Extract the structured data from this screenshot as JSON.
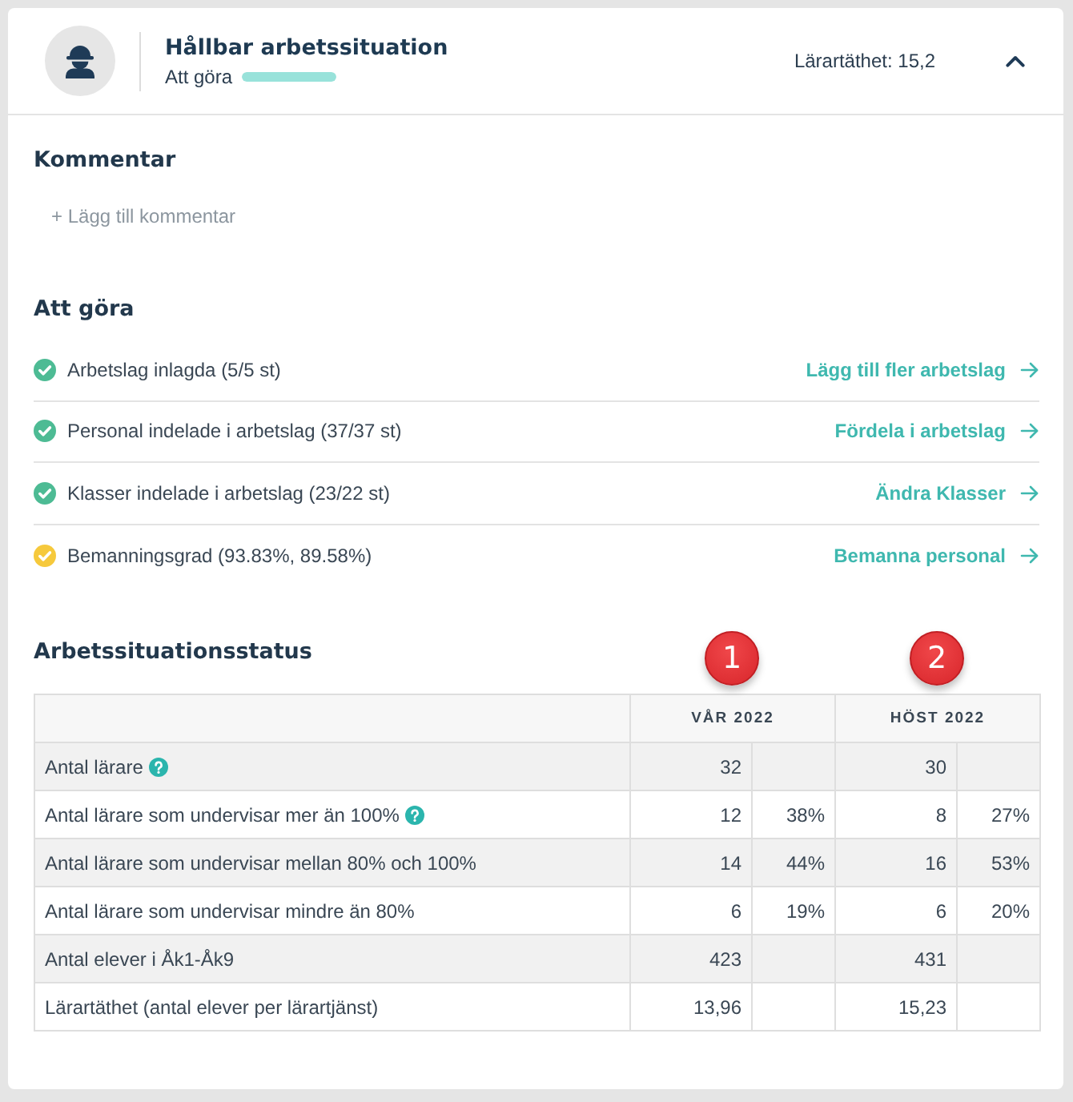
{
  "header": {
    "title": "Hållbar arbetssituation",
    "status_label": "Att göra",
    "progress": {
      "level": 1
    },
    "density": "Lärartäthet: 15,2",
    "expanded": true
  },
  "comment": {
    "heading": "Kommentar",
    "add_link": "+ Lägg till kommentar"
  },
  "todo": {
    "heading": "Att göra",
    "items": [
      {
        "text": "Arbetslag inlagda (5/5 st)",
        "color": "#4dbb94",
        "action": "Lägg till fler arbetslag"
      },
      {
        "text": "Personal indelade i arbetslag (37/37 st)",
        "color": "#4dbb94",
        "action": "Fördela i arbetslag"
      },
      {
        "text": "Klasser indelade i arbetslag (23/22 st)",
        "color": "#4dbb94",
        "action": "Ändra Klasser"
      },
      {
        "text": "Bemanningsgrad (93.83%, 89.58%)",
        "color": "#f6c93c",
        "action": "Bemanna personal"
      }
    ]
  },
  "status_table": {
    "heading": "Arbetssituationsstatus",
    "columns": [
      {
        "label": "VÅR 2022",
        "marker": "1"
      },
      {
        "label": "HÖST 2022",
        "marker": "2"
      }
    ],
    "rows": [
      {
        "label": "Antal lärare",
        "help": true,
        "values": [
          {
            "count": "32"
          },
          {
            "count": "30"
          }
        ]
      },
      {
        "label": "Antal lärare som undervisar mer än 100%",
        "help": true,
        "values": [
          {
            "count": "12",
            "share": "38%"
          },
          {
            "count": "8",
            "share": "27%"
          }
        ]
      },
      {
        "label": "Antal lärare som undervisar mellan 80% och 100%",
        "help": false,
        "values": [
          {
            "count": "14",
            "share": "44%"
          },
          {
            "count": "16",
            "share": "53%"
          }
        ]
      },
      {
        "label": "Antal lärare som undervisar mindre än 80%",
        "help": false,
        "values": [
          {
            "count": "6",
            "share": "19%"
          },
          {
            "count": "6",
            "share": "20%"
          }
        ]
      },
      {
        "label": "Antal elever i Åk1-Åk9",
        "help": false,
        "values": [
          {
            "count": "423"
          },
          {
            "count": "431"
          }
        ]
      },
      {
        "label": "Lärartäthet (antal elever per lärartjänst)",
        "help": false,
        "values": [
          {
            "count": "13,96"
          },
          {
            "count": "15,23"
          }
        ]
      }
    ]
  }
}
